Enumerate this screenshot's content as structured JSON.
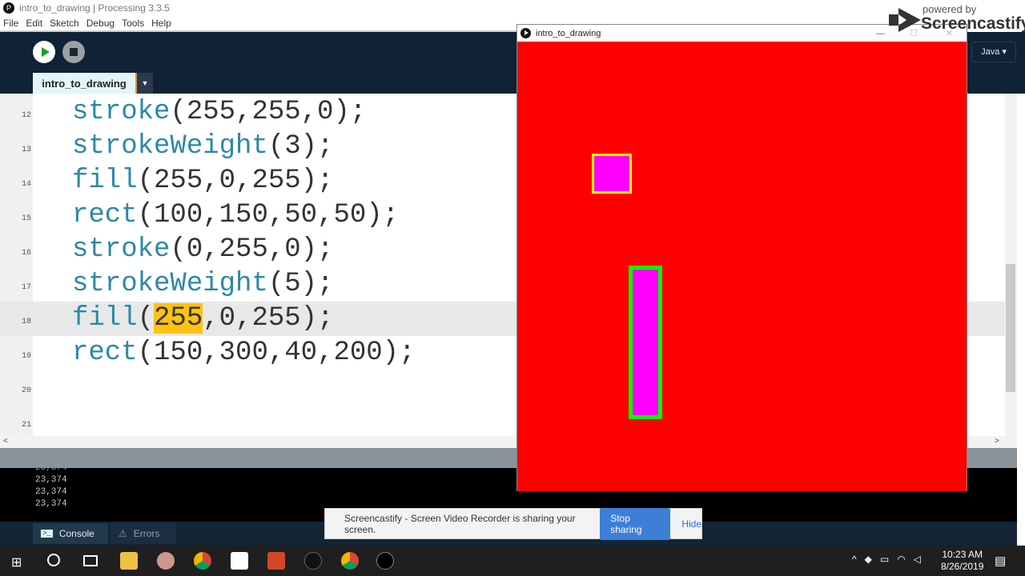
{
  "window_title": "intro_to_drawing | Processing 3.3.5",
  "menu": [
    "File",
    "Edit",
    "Sketch",
    "Debug",
    "Tools",
    "Help"
  ],
  "tab_name": "intro_to_drawing",
  "mode": "Java ▾",
  "code_lines": [
    {
      "num": "12",
      "fn": "stroke",
      "args": "(255,255,0);"
    },
    {
      "num": "13",
      "fn": "strokeWeight",
      "args": "(3);"
    },
    {
      "num": "14",
      "fn": "fill",
      "args": "(255,0,255);"
    },
    {
      "num": "15",
      "fn": "rect",
      "args": "(100,150,50,50);"
    },
    {
      "num": "16",
      "fn": "stroke",
      "args": "(0,255,0);"
    },
    {
      "num": "17",
      "fn": "strokeWeight",
      "args": "(5);"
    },
    {
      "num": "18",
      "fn": "fill",
      "pre": "(",
      "hl": "255",
      "args": ",0,255);"
    },
    {
      "num": "19",
      "fn": "rect",
      "args": "(150,300,40,200);"
    },
    {
      "num": "20",
      "fn": "",
      "args": ""
    },
    {
      "num": "21",
      "fn": "",
      "args": ""
    }
  ],
  "console_lines": [
    "23,374",
    "23,374",
    "23,374",
    "23,374"
  ],
  "bottom_tabs": {
    "console": "Console",
    "errors": "Errors"
  },
  "sketch_title": "intro_to_drawing",
  "watermark": {
    "line1": "powered by",
    "line2": "Screencastify"
  },
  "notification": {
    "text": "Screencastify - Screen Video Recorder is sharing your screen.",
    "stop": "Stop sharing",
    "hide": "Hide"
  },
  "clock": {
    "time": "10:23 AM",
    "date": "8/26/2019"
  },
  "colors": {
    "canvas": "#ff0000",
    "rect_fill": "#ff00ff",
    "stroke1": "#ffff00",
    "stroke2": "#00ff00"
  }
}
